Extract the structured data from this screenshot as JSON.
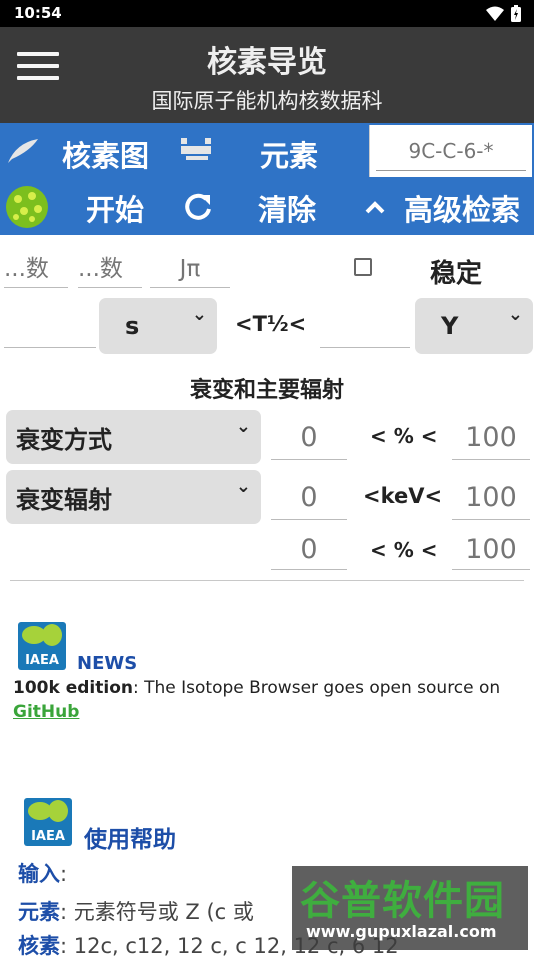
{
  "status": {
    "time": "10:54"
  },
  "app": {
    "title": "核素导览",
    "subtitle": "国际原子能机构核数据科"
  },
  "tabs": {
    "chart_label": "核素图",
    "elements_label": "元素",
    "search_placeholder": "9C-C-6-*",
    "start_label": "开始",
    "clear_label": "清除",
    "advanced_label": "高级检索"
  },
  "filters": {
    "z_placeholder": "...数",
    "n_placeholder": "...数",
    "jpi_placeholder": "Jπ",
    "stable_label": "稳定",
    "half_life_unit_left": "s",
    "half_life_label": "<T½<",
    "half_life_unit_right": "Y",
    "decay_section_title": "衰变和主要辐射",
    "decay_mode_label": "衰变方式",
    "decay_mode_min": "0",
    "decay_mode_op": "< % <",
    "decay_mode_max": "100",
    "radiation_label": "衰变辐射",
    "radiation_min": "0",
    "radiation_op": "<keV<",
    "radiation_max": "100",
    "intensity_min": "0",
    "intensity_op": "< % <",
    "intensity_max": "100"
  },
  "news": {
    "logo_text": "IAEA",
    "title": "NEWS",
    "bold_part": "100k edition",
    "text": ": The Isotope Browser goes open source on",
    "link": "GitHub"
  },
  "help": {
    "logo_text": "IAEA",
    "title": "使用帮助",
    "input_label": "输入",
    "input_colon": ":",
    "element_label": "元素",
    "element_text": ": 元素符号或 Z (c 或",
    "nuclide_label": "核素",
    "nuclide_text": ": 12c, c12, 12 c, c 12, 12 c, 6 12"
  },
  "watermark": {
    "big": "谷普软件园",
    "small": "www.gupuxlazal.com"
  },
  "colors": {
    "appbar": "#3a3a3a",
    "tabbar": "#2f73c6",
    "accent_green": "#3aa53a",
    "link_blue": "#1d4ea8"
  },
  "icons": [
    "menu-icon",
    "feather-icon",
    "table-icon",
    "nuclide-ball-icon",
    "refresh-icon",
    "chevron-up-icon",
    "wifi-icon",
    "battery-icon"
  ]
}
